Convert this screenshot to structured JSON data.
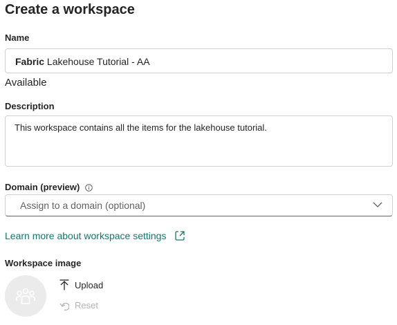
{
  "page": {
    "title": "Create a workspace"
  },
  "name": {
    "label": "Name",
    "value_bold": "Fabric",
    "value_rest": " Lakehouse Tutorial - AA",
    "status": "Available"
  },
  "description": {
    "label": "Description",
    "value": "This workspace contains all the items for the lakehouse tutorial."
  },
  "domain": {
    "label": "Domain (preview)",
    "info_icon": "info-icon",
    "placeholder": "Assign to a domain (optional)",
    "chevron_icon": "chevron-down-icon"
  },
  "settings_link": {
    "text": "Learn more about workspace settings",
    "icon": "external-link-icon",
    "color": "#117865"
  },
  "workspace_image": {
    "label": "Workspace image",
    "avatar_icon": "group-icon",
    "upload_label": "Upload",
    "reset_label": "Reset"
  }
}
